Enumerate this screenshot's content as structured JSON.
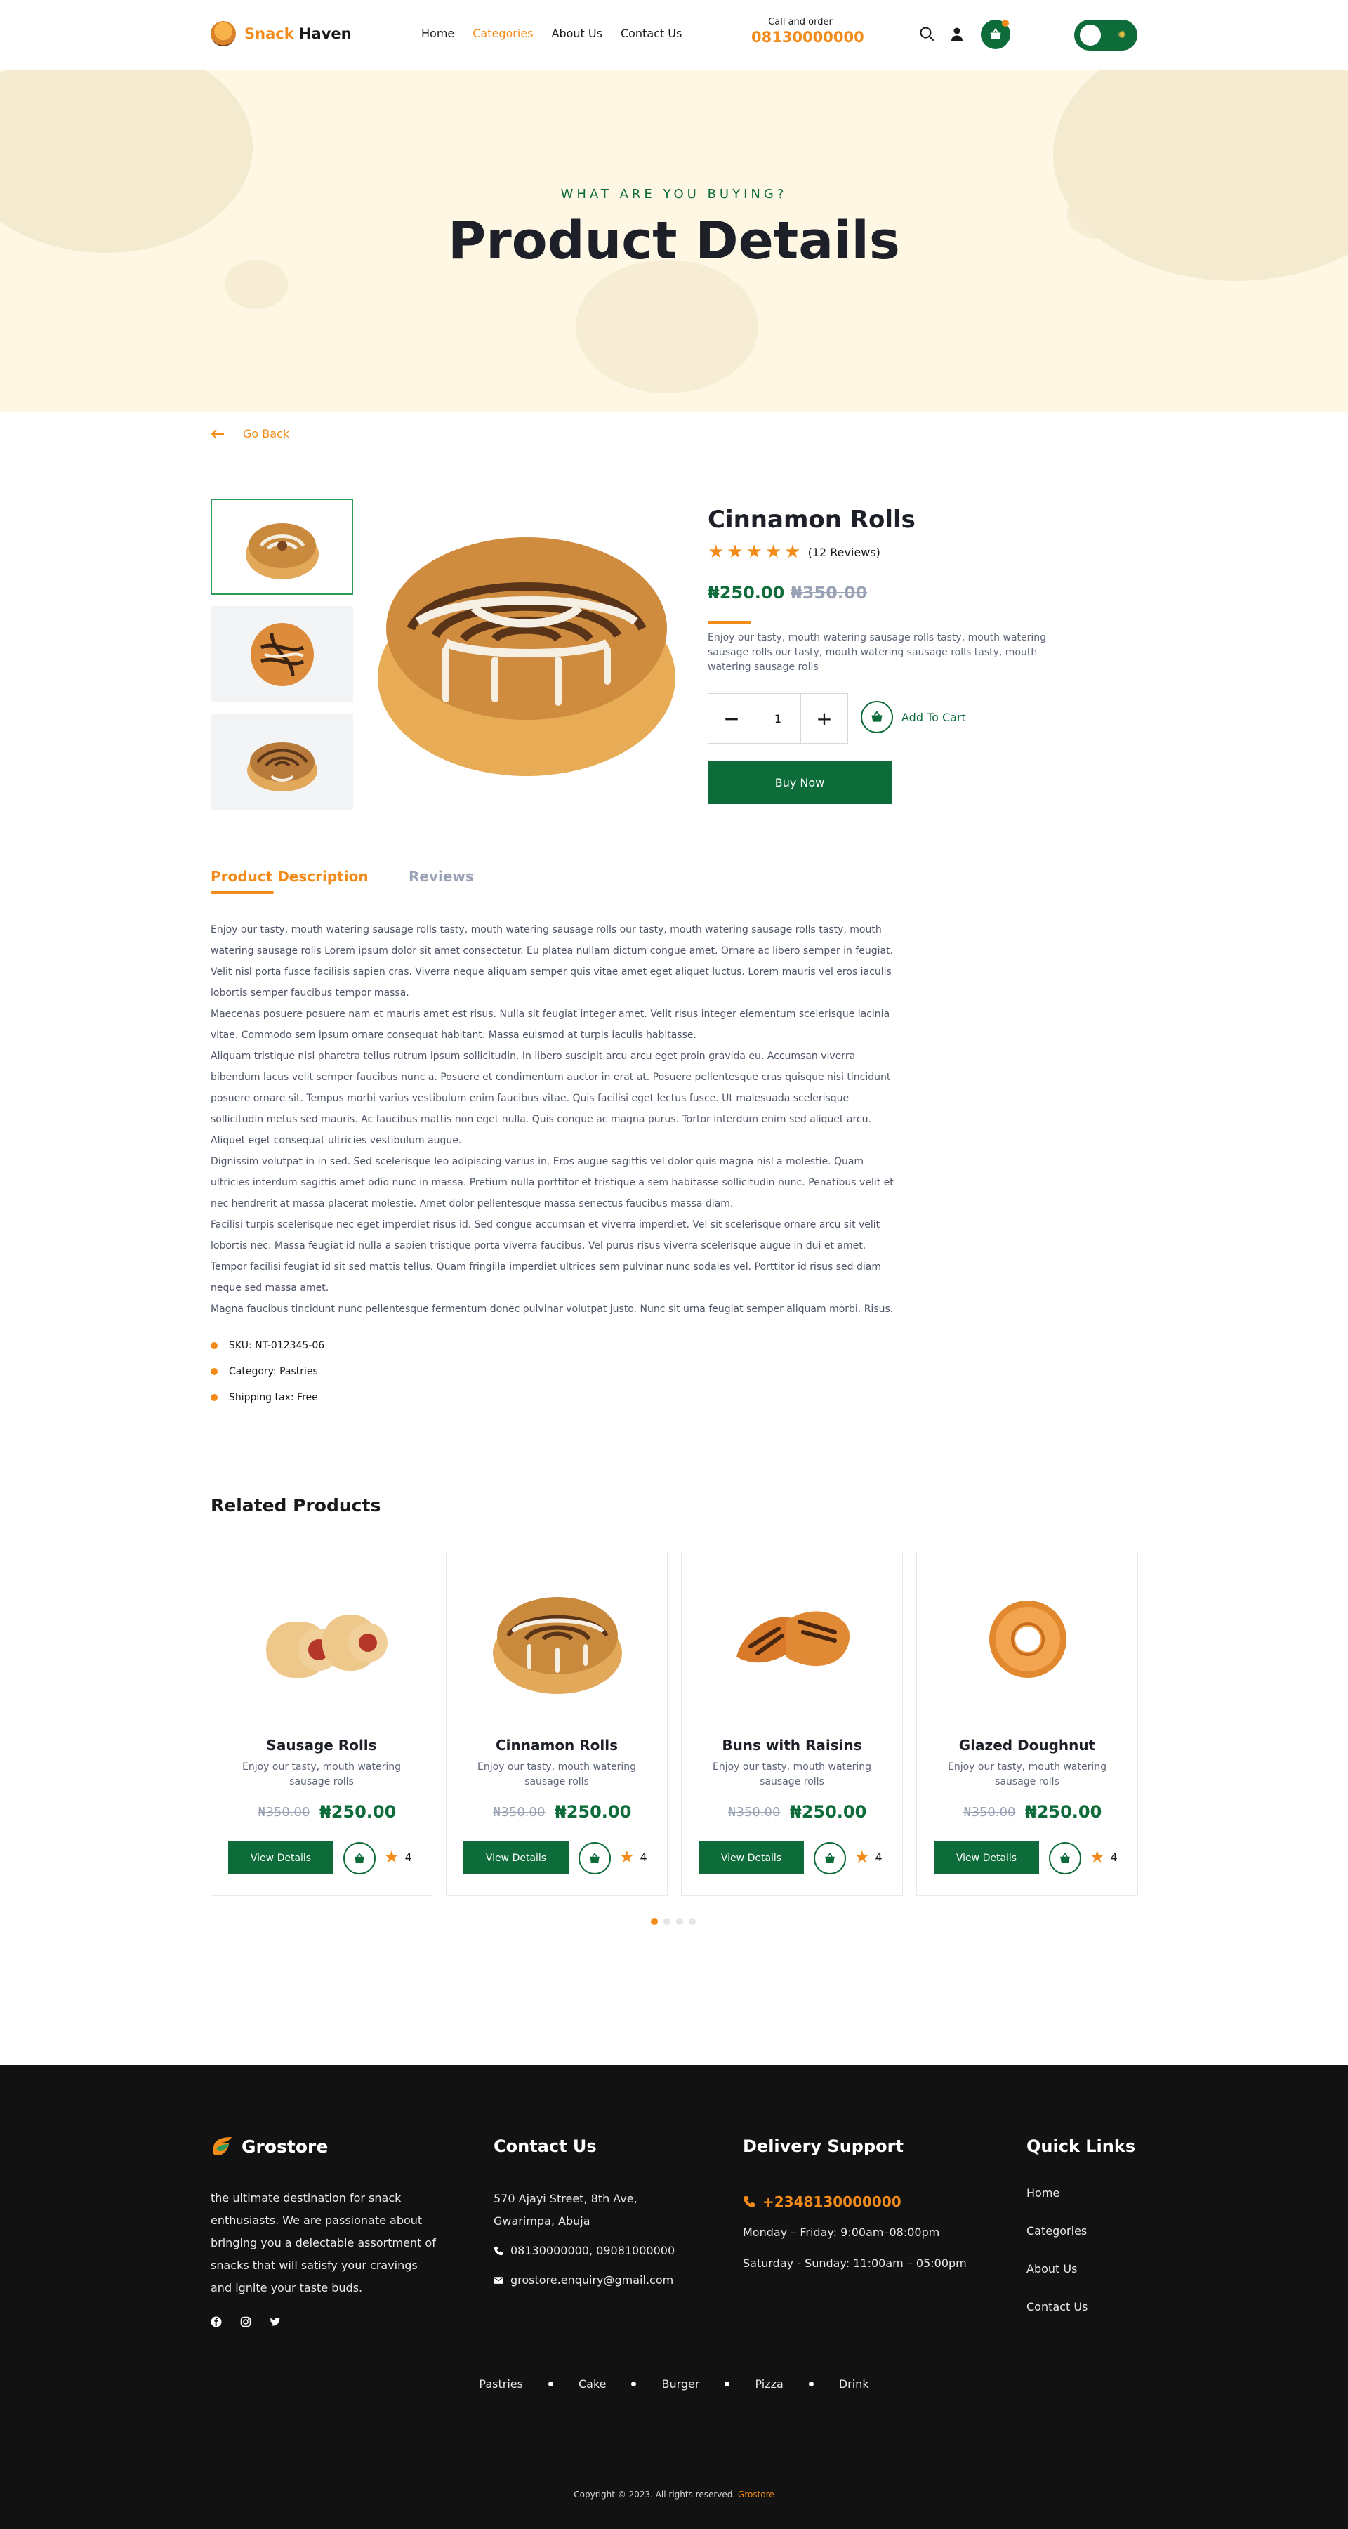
{
  "header": {
    "brand_part1": "Snack",
    "brand_part2": "Haven",
    "nav": [
      "Home",
      "Categories",
      "About Us",
      "Contact Us"
    ],
    "active_nav": "Categories",
    "call_label": "Call and order",
    "call_number": "08130000000",
    "icons": [
      "search-icon",
      "user-icon",
      "cart-icon",
      "sun-icon"
    ]
  },
  "banner": {
    "kicker": "WHAT ARE YOU BUYING?",
    "title": "Product Details"
  },
  "go_back": "Go Back",
  "product": {
    "name": "Cinnamon Rolls",
    "rating": 5,
    "reviews": "(12 Reviews)",
    "price": "₦250.00",
    "old_price": "₦350.00",
    "short_desc": "Enjoy our tasty, mouth watering sausage rolls tasty, mouth watering sausage rolls our tasty, mouth watering sausage rolls tasty, mouth watering sausage rolls",
    "quantity": "1",
    "add_to_cart": "Add To Cart",
    "buy_now": "Buy Now"
  },
  "tabs": {
    "description": "Product Description",
    "reviews": "Reviews"
  },
  "long_description": [
    "Enjoy our tasty, mouth watering sausage rolls tasty, mouth watering sausage rolls our tasty, mouth watering sausage rolls tasty, mouth watering sausage rolls Lorem ipsum dolor sit amet consectetur. Eu platea nullam dictum congue amet. Ornare ac libero semper in feugiat. Velit nisl porta fusce facilisis sapien cras. Viverra neque aliquam semper quis vitae amet eget aliquet luctus. Lorem mauris vel eros iaculis lobortis semper faucibus tempor massa.",
    "Maecenas posuere posuere nam et mauris amet est risus. Nulla sit feugiat integer amet. Velit risus integer elementum scelerisque lacinia vitae. Commodo sem ipsum ornare consequat habitant. Massa euismod at turpis iaculis habitasse.",
    "Aliquam tristique nisl pharetra tellus rutrum ipsum sollicitudin. In libero suscipit arcu arcu eget proin gravida eu. Accumsan viverra bibendum lacus velit semper faucibus nunc a. Posuere et condimentum auctor in erat at. Posuere pellentesque cras quisque nisi tincidunt posuere ornare sit. Tempus morbi varius vestibulum enim faucibus vitae. Quis facilisi eget lectus fusce. Ut malesuada scelerisque sollicitudin metus sed mauris. Ac faucibus mattis non eget nulla. Quis congue ac magna purus. Tortor interdum enim sed aliquet arcu. Aliquet eget consequat ultricies vestibulum augue.",
    "Dignissim volutpat in in sed. Sed scelerisque leo adipiscing varius in. Eros augue sagittis vel dolor quis magna nisl a molestie. Quam ultricies interdum sagittis amet odio nunc in massa. Pretium nulla porttitor et tristique a sem habitasse sollicitudin nunc. Penatibus velit et nec hendrerit at massa placerat molestie. Amet dolor pellentesque massa senectus faucibus massa diam.",
    "Facilisi turpis scelerisque nec eget imperdiet risus id. Sed congue accumsan et viverra imperdiet. Vel sit scelerisque ornare arcu sit velit lobortis nec. Massa feugiat id nulla a sapien tristique porta viverra faucibus. Vel purus risus viverra scelerisque augue in dui et amet. Tempor facilisi feugiat id sit sed mattis tellus. Quam fringilla imperdiet ultrices sem pulvinar nunc sodales vel. Porttitor id risus sed diam neque sed massa amet.",
    "Magna faucibus tincidunt nunc pellentesque fermentum donec pulvinar volutpat justo. Nunc sit urna feugiat semper aliquam morbi. Risus."
  ],
  "meta": [
    "SKU: NT-012345-06",
    "Category: Pastries",
    "Shipping tax: Free"
  ],
  "related": {
    "title": "Related Products",
    "items": [
      {
        "name": "Sausage Rolls",
        "desc": "Enjoy our tasty, mouth watering sausage rolls",
        "old": "₦350.00",
        "price": "₦250.00",
        "btn": "View Details",
        "rating": "4"
      },
      {
        "name": "Cinnamon Rolls",
        "desc": "Enjoy our tasty, mouth watering sausage rolls",
        "old": "₦350.00",
        "price": "₦250.00",
        "btn": "View Details",
        "rating": "4"
      },
      {
        "name": "Buns with Raisins",
        "desc": "Enjoy our tasty, mouth watering sausage rolls",
        "old": "₦350.00",
        "price": "₦250.00",
        "btn": "View Details",
        "rating": "4"
      },
      {
        "name": "Glazed Doughnut",
        "desc": "Enjoy our tasty, mouth watering sausage rolls",
        "old": "₦350.00",
        "price": "₦250.00",
        "btn": "View Details",
        "rating": "4"
      }
    ]
  },
  "footer": {
    "brand": "Grostore",
    "about": "the ultimate destination for snack enthusiasts. We are passionate about bringing you a delectable assortment of snacks that will satisfy your cravings and ignite your taste buds.",
    "social": [
      "facebook-icon",
      "instagram-icon",
      "twitter-icon"
    ],
    "contact_title": "Contact Us",
    "address": "570 Ajayi Street, 8th Ave, Gwarimpa, Abuja",
    "phones": "08130000000,  09081000000",
    "email": "grostore.enquiry@gmail.com",
    "delivery_title": "Delivery Support",
    "delivery_phone": "+2348130000000",
    "hours1": "Monday – Friday: 9:00am–08:00pm",
    "hours2": "Saturday - Sunday: 11:00am – 05:00pm",
    "links_title": "Quick Links",
    "links": [
      "Home",
      "Categories",
      "About Us",
      "Contact Us"
    ],
    "categories": [
      "Pastries",
      "Cake",
      "Burger",
      "Pizza",
      "Drink"
    ],
    "copyright": "Copyright © 2023. All rights reserved.",
    "copyright_brand": "Grostore"
  },
  "colors": {
    "brand_green": "#0e6b3a",
    "accent_orange": "#f28b1a",
    "banner_bg": "#fdf7e3",
    "footer_bg": "#121212"
  }
}
